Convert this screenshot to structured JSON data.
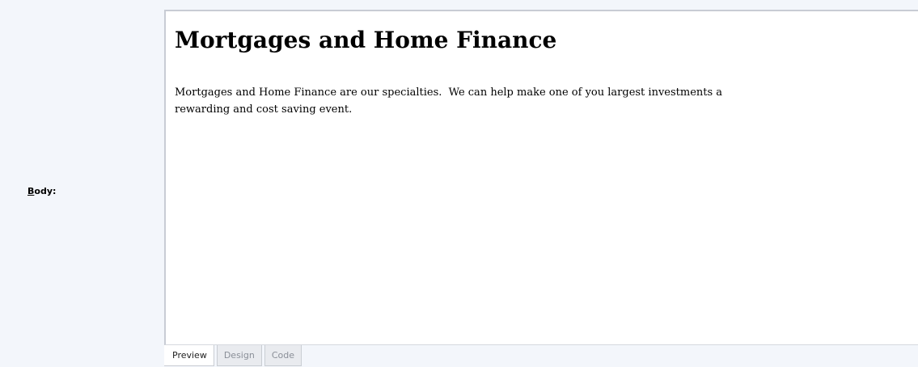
{
  "field": {
    "label_accesskey": "B",
    "label_rest": "ody:"
  },
  "editor": {
    "title": "Mortgages and Home Finance",
    "body": "Mortgages and Home Finance are our specialties.  We can help make one of you largest investments a\nrewarding and cost saving event."
  },
  "tabs": [
    {
      "label": "Preview",
      "active": true
    },
    {
      "label": "Design",
      "active": false
    },
    {
      "label": "Code",
      "active": false
    }
  ]
}
